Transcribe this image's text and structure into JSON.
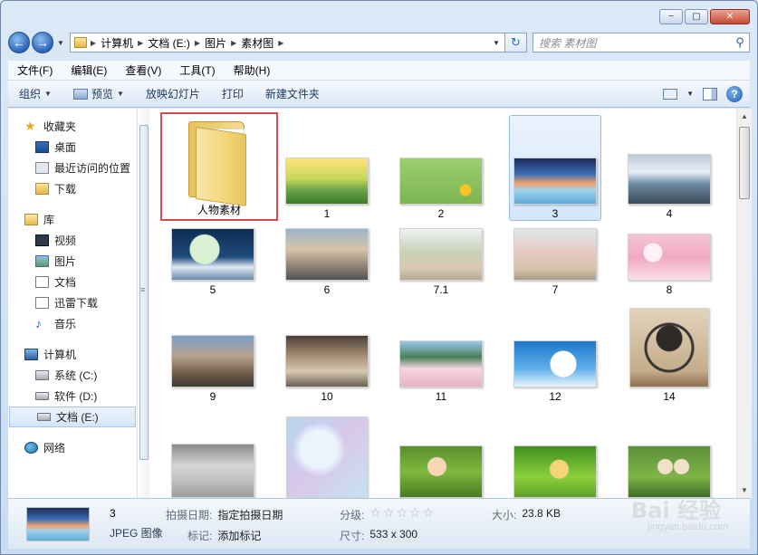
{
  "window": {
    "caption_buttons": [
      "−",
      "▢",
      "✕"
    ]
  },
  "address": {
    "crumbs": [
      "计算机",
      "文档 (E:)",
      "图片",
      "素材图"
    ]
  },
  "search": {
    "placeholder": "搜索 素材图"
  },
  "menu": [
    "文件(F)",
    "编辑(E)",
    "查看(V)",
    "工具(T)",
    "帮助(H)"
  ],
  "toolbar": {
    "organize": "组织",
    "preview": "预览",
    "slideshow": "放映幻灯片",
    "print": "打印",
    "new_folder": "新建文件夹"
  },
  "nav": {
    "favorites": "收藏夹",
    "desktop": "桌面",
    "recent": "最近访问的位置",
    "downloads": "下载",
    "libraries": "库",
    "videos": "视频",
    "pictures": "图片",
    "documents": "文档",
    "xunlei": "迅雷下载",
    "music": "音乐",
    "computer": "计算机",
    "drive_c": "系统 (C:)",
    "drive_d": "软件 (D:)",
    "drive_e": "文档 (E:)",
    "network": "网络"
  },
  "files": [
    {
      "label": "人物素材",
      "kind": "folder"
    },
    {
      "label": "1"
    },
    {
      "label": "2"
    },
    {
      "label": "3"
    },
    {
      "label": "4"
    },
    {
      "label": "5"
    },
    {
      "label": "6"
    },
    {
      "label": "7.1"
    },
    {
      "label": "7"
    },
    {
      "label": "8"
    },
    {
      "label": "9"
    },
    {
      "label": "10"
    },
    {
      "label": "11"
    },
    {
      "label": "12"
    },
    {
      "label": "14"
    }
  ],
  "details": {
    "name": "3",
    "type": "JPEG 图像",
    "date_key": "拍摄日期:",
    "date_val": "指定拍摄日期",
    "tag_key": "标记:",
    "tag_val": "添加标记",
    "rating_key": "分级:",
    "rating_val": "☆☆☆☆☆",
    "size_key": "大小:",
    "size_val": "23.8 KB",
    "dim_key": "尺寸:",
    "dim_val": "533 x 300"
  },
  "watermark": {
    "text": "Bai 经验",
    "url": "jingyan.baidu.com"
  },
  "colors": {
    "highlight_border": "#d94a4a",
    "selection_bg": "#d5e6fa"
  }
}
